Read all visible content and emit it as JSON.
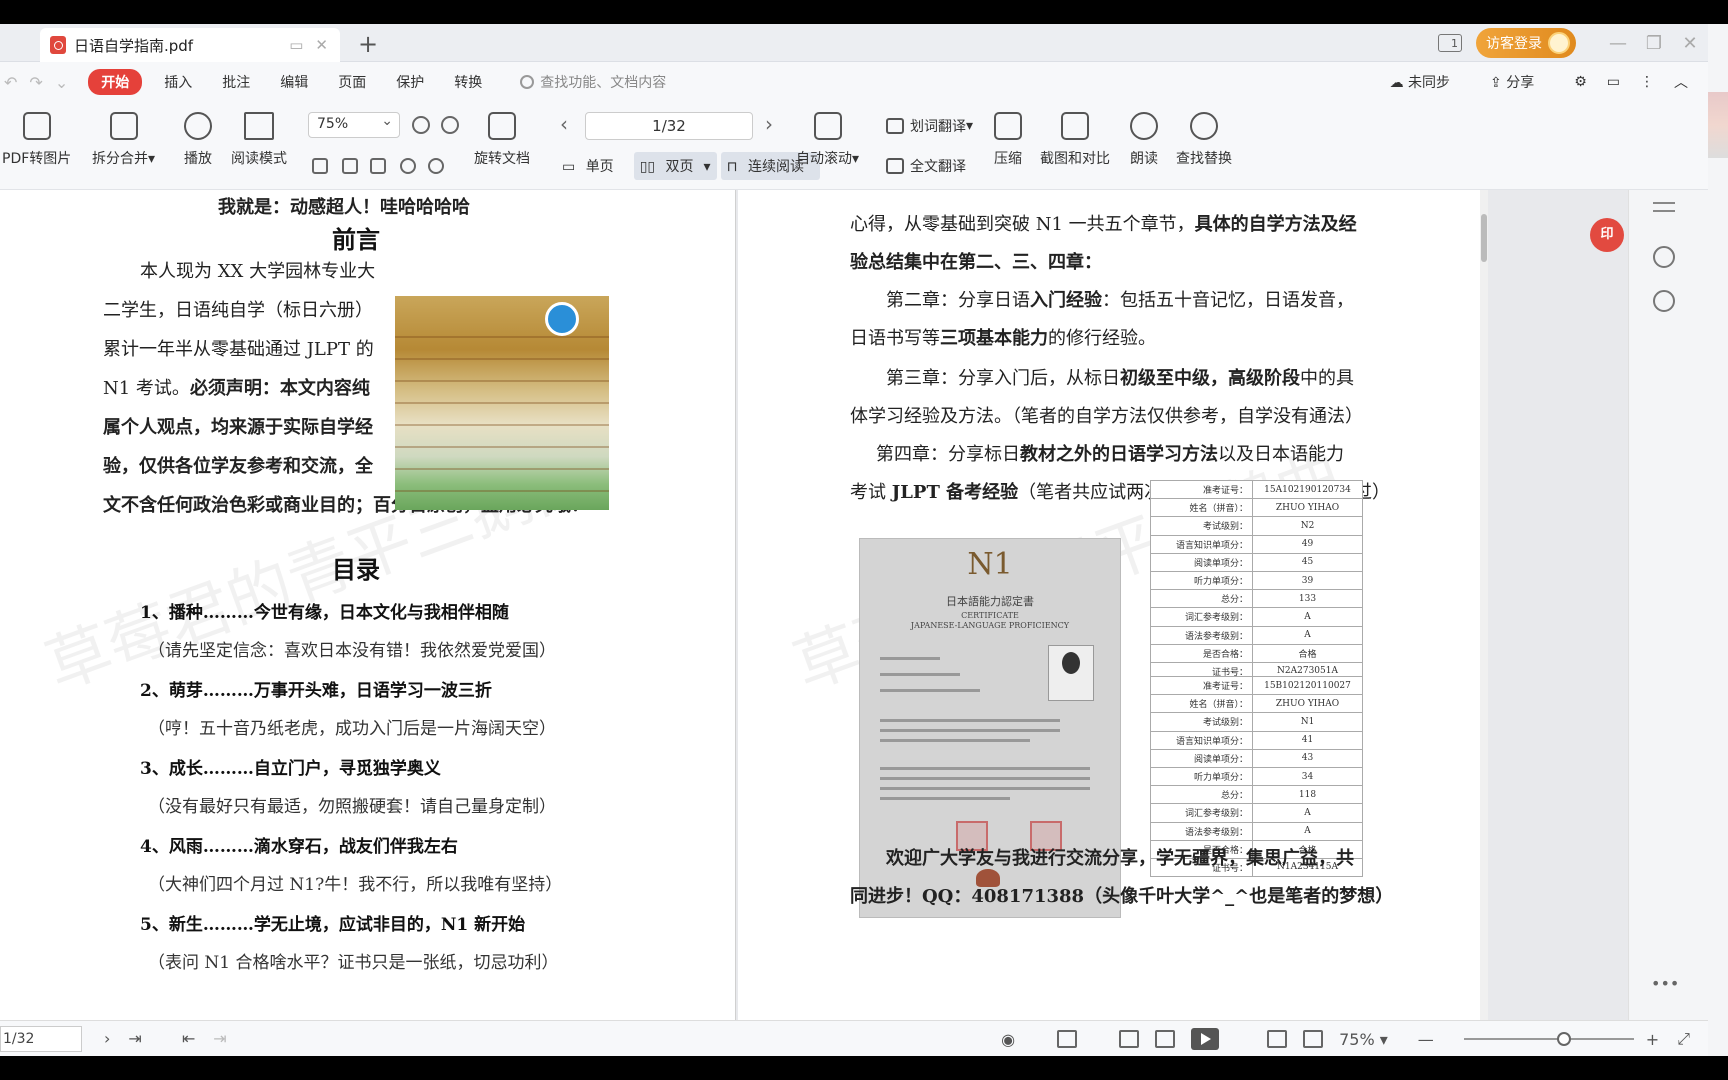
{
  "tab": {
    "title": "日语自学指南.pdf"
  },
  "header": {
    "visitor_login": "访客登录",
    "page_icon_label": "1"
  },
  "menu": {
    "start": "开始",
    "items": [
      "插入",
      "批注",
      "编辑",
      "页面",
      "保护",
      "转换"
    ],
    "search_placeholder": "查找功能、文档内容",
    "sync": "未同步",
    "share": "分享"
  },
  "toolbar": {
    "pdf_to_image": "PDF转图片",
    "split_merge": "拆分合并",
    "play": "播放",
    "read_mode": "阅读模式",
    "zoom": "75%",
    "rotate": "旋转文档",
    "page_indicator": "1/32",
    "single_page": "单页",
    "double_page": "双页",
    "continuous": "连续阅读",
    "auto_scroll": "自动滚动",
    "word_translate": "划词翻译",
    "full_translate": "全文翻译",
    "compress": "压缩",
    "screenshot_compare": "截图和对比",
    "read_aloud": "朗读",
    "find_replace": "查找替换"
  },
  "left_page": {
    "top_line": "我就是：动感超人！哇哈哈哈哈",
    "preface_title": "前言",
    "preface_lines": [
      "本人现为 XX 大学园林专业大",
      "二学生，日语纯自学（标日六册）",
      "累计一年半从零基础通过 JLPT 的",
      "N1 考试。",
      "必须声明：本文内容纯",
      "属个人观点，均来源于实际自学经",
      "验，仅供各位学友参考和交流，全",
      "文不含任何政治色彩或商业目的；百分百原创，盗用必究哦！"
    ],
    "toc_title": "目录",
    "toc": [
      {
        "title": "1、播种………今世有缘，日本文化与我相伴相随",
        "sub": "（请先坚定信念：喜欢日本没有错！我依然爱党爱国）"
      },
      {
        "title": "2、萌芽………万事开头难，日语学习一波三折",
        "sub": "（哼！五十音乃纸老虎，成功入门后是一片海阔天空）"
      },
      {
        "title": "3、成长………自立门户，寻觅独学奥义",
        "sub": "（没有最好只有最适，勿照搬硬套！请自己量身定制）"
      },
      {
        "title": "4、风雨………滴水穿石，战友们伴我左右",
        "sub": "（大神们四个月过 N1?牛！我不行，所以我唯有坚持）"
      },
      {
        "title": "5、新生………学无止境，应试非目的，N1 新开始",
        "sub": "（表问 N1 合格啥水平？证书只是一张纸，切忌功利）"
      }
    ]
  },
  "right_page": {
    "line1_a": "心得，从零基础到突破 N1 一共五个章节，",
    "line1_b": "具体的自学方法及经",
    "line2": "验总结集中在第二、三、四章：",
    "ch2_a": "第二章：分享日语",
    "ch2_b": "入门经验",
    "ch2_c": "：包括五十音记忆，日语发音，",
    "ch2_d": "日语书写等",
    "ch2_e": "三项基本能力",
    "ch2_f": "的修行经验。",
    "ch3_a": "第三章：分享入门后，从标日",
    "ch3_b": "初级至中级，高级阶段",
    "ch3_c": "中的具",
    "ch3_d": "体学习经验及方法。（笔者的自学方法仅供参考，自学没有通法）",
    "ch4_a": "第四章：分享标日",
    "ch4_b": "教材之外的日语学习方法",
    "ch4_c": "以及日本语能力",
    "ch4_d": "考试 ",
    "ch4_e": "JLPT 备考经验",
    "ch4_f": "（笔者共应试两次 N2、N1 幸运的一次通过）",
    "cert": {
      "level": "N1",
      "jp_title": "日本語能力認定書",
      "en_title1": "CERTIFICATE",
      "en_title2": "JAPANESE-LANGUAGE PROFICIENCY"
    },
    "closing_a": "欢迎广大学友与我进行交流分享，学无疆界，集思广益，共",
    "closing_b": "同进步！QQ：408171388（头像千叶大学^_^也是笔者的梦想）"
  },
  "score_table_1": [
    [
      "准考证号：",
      "15A102190120734"
    ],
    [
      "姓名（拼音）：",
      "ZHUO YIHAO"
    ],
    [
      "考试级别：",
      "N2"
    ],
    [
      "语言知识单项分：",
      "49"
    ],
    [
      "阅读单项分：",
      "45"
    ],
    [
      "听力单项分：",
      "39"
    ],
    [
      "总分：",
      "133"
    ],
    [
      "词汇参考级别：",
      "A"
    ],
    [
      "语法参考级别：",
      "A"
    ],
    [
      "是否合格：",
      "合格"
    ],
    [
      "证书号：",
      "N2A273051A"
    ]
  ],
  "score_table_2": [
    [
      "准考证号：",
      "15B102120110027"
    ],
    [
      "姓名（拼音）：",
      "ZHUO YIHAO"
    ],
    [
      "考试级别：",
      "N1"
    ],
    [
      "语言知识单项分：",
      "41"
    ],
    [
      "阅读单项分：",
      "43"
    ],
    [
      "听力单项分：",
      "34"
    ],
    [
      "总分：",
      "118"
    ],
    [
      "词汇参考级别：",
      "A"
    ],
    [
      "语法参考级别：",
      "A"
    ],
    [
      "是否合格：",
      "合格"
    ],
    [
      "证书号：",
      "N1A234115A"
    ]
  ],
  "watermark": "草莓君的青平三鹅曲",
  "stamp": "印",
  "status": {
    "page": "1/32",
    "zoom": "75%"
  }
}
